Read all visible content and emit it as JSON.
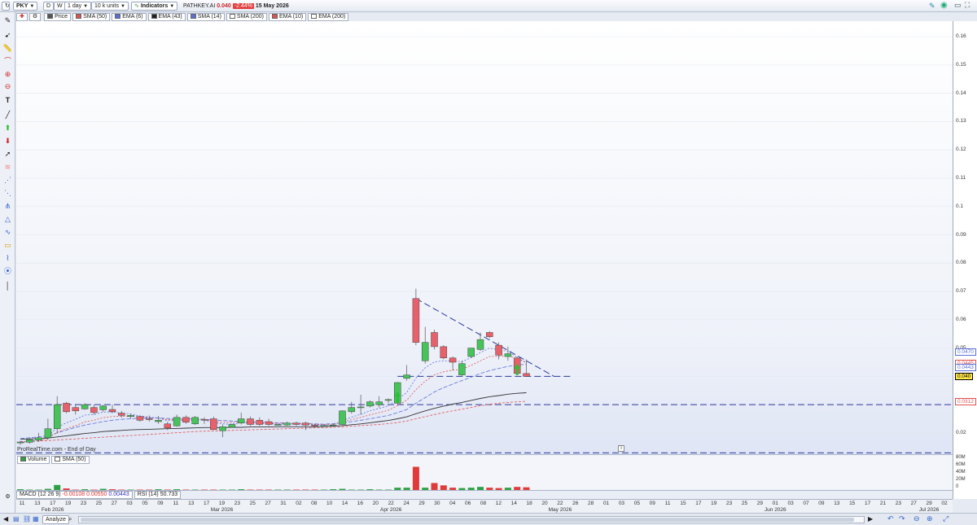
{
  "toolbar": {
    "symbol": "PKY",
    "d_label": "D",
    "w_label": "W",
    "timeframe": "1 day",
    "units": "10 k units",
    "indicators_label": "Indicators",
    "ticker": "PATHKEY.AI",
    "last_price": "0.040",
    "change": "-2.44%",
    "date": "15 May 2026"
  },
  "legend": {
    "items": [
      {
        "label": "Price",
        "color": "#555555"
      },
      {
        "label": "SMA (50)",
        "color": "#e05050"
      },
      {
        "label": "EMA (6)",
        "color": "#5a6fd6"
      },
      {
        "label": "EMA (43)",
        "color": "#222222"
      },
      {
        "label": "SMA (14)",
        "color": "#5a6fd6"
      },
      {
        "label": "SMA (200)",
        "color": "#ffffff"
      },
      {
        "label": "EMA (10)",
        "color": "#e05050"
      },
      {
        "label": "EMA (200)",
        "color": "#ffffff"
      }
    ]
  },
  "watermark": "ProRealTime.com - End of Day",
  "volume_legend": {
    "volume": "Volume",
    "sma": "SMA (50)"
  },
  "macd": {
    "label": "MACD (12 26 9)",
    "v1": "-0.00108",
    "v2": "0.00550",
    "v3": "0.00443"
  },
  "rsi": {
    "label": "RSI (14)",
    "value": "50.733"
  },
  "bottom": {
    "analyze": "Analyze"
  },
  "y_axis": {
    "ticks": [
      "0.16",
      "0.15",
      "0.14",
      "0.13",
      "0.12",
      "0.11",
      "0.1",
      "0.09",
      "0.08",
      "0.07",
      "0.06",
      "0.05",
      "0.02"
    ],
    "tags": [
      {
        "label": "0.0470",
        "color": "#5a6fd6"
      },
      {
        "label": "0.0445",
        "color": "#e05050"
      },
      {
        "label": "0.0443",
        "color": "#5a6fd6"
      },
      {
        "label": "0.040",
        "color": "#000000",
        "bg": "#ffe84a"
      },
      {
        "label": "0.0312",
        "color": "#e05050"
      }
    ]
  },
  "volume_axis": [
    "80M",
    "60M",
    "40M",
    "20M",
    "0"
  ],
  "x_axis": {
    "days": [
      "11",
      "13",
      "17",
      "19",
      "23",
      "25",
      "27",
      "03",
      "05",
      "09",
      "11",
      "13",
      "17",
      "19",
      "23",
      "25",
      "27",
      "31",
      "02",
      "08",
      "10",
      "14",
      "16",
      "20",
      "22",
      "24",
      "29",
      "30",
      "04",
      "06",
      "08",
      "12",
      "14",
      "18",
      "20",
      "22",
      "26",
      "28",
      "01",
      "03",
      "05",
      "09",
      "11",
      "15",
      "17",
      "19",
      "23",
      "25",
      "29",
      "01",
      "03",
      "07",
      "09",
      "13",
      "15",
      "17",
      "21",
      "23",
      "27",
      "29",
      "02"
    ],
    "months": [
      "Feb 2026",
      "Mar 2026",
      "Apr 2026",
      "May 2026",
      "Jun 2026",
      "Jul 2026"
    ]
  },
  "chart_data": {
    "type": "candlestick",
    "ylim": [
      0.0125,
      0.1655
    ],
    "candles": [
      {
        "o": 0.0165,
        "h": 0.0172,
        "l": 0.0158,
        "c": 0.0168
      },
      {
        "o": 0.0167,
        "h": 0.0182,
        "l": 0.0162,
        "c": 0.0176
      },
      {
        "o": 0.0175,
        "h": 0.02,
        "l": 0.0168,
        "c": 0.0183
      },
      {
        "o": 0.0183,
        "h": 0.025,
        "l": 0.0176,
        "c": 0.0215
      },
      {
        "o": 0.0215,
        "h": 0.033,
        "l": 0.02,
        "c": 0.03
      },
      {
        "o": 0.0305,
        "h": 0.031,
        "l": 0.027,
        "c": 0.0275
      },
      {
        "o": 0.029,
        "h": 0.03,
        "l": 0.0265,
        "c": 0.0278
      },
      {
        "o": 0.0285,
        "h": 0.0305,
        "l": 0.0282,
        "c": 0.03
      },
      {
        "o": 0.029,
        "h": 0.03,
        "l": 0.0265,
        "c": 0.0272
      },
      {
        "o": 0.0282,
        "h": 0.03,
        "l": 0.0275,
        "c": 0.0295
      },
      {
        "o": 0.0283,
        "h": 0.03,
        "l": 0.027,
        "c": 0.0275
      },
      {
        "o": 0.027,
        "h": 0.0278,
        "l": 0.0255,
        "c": 0.0262
      },
      {
        "o": 0.0258,
        "h": 0.0268,
        "l": 0.025,
        "c": 0.0262
      },
      {
        "o": 0.0258,
        "h": 0.0262,
        "l": 0.024,
        "c": 0.0245
      },
      {
        "o": 0.025,
        "h": 0.0262,
        "l": 0.024,
        "c": 0.0248
      },
      {
        "o": 0.024,
        "h": 0.026,
        "l": 0.0232,
        "c": 0.0245
      },
      {
        "o": 0.0232,
        "h": 0.024,
        "l": 0.021,
        "c": 0.0218
      },
      {
        "o": 0.0225,
        "h": 0.0265,
        "l": 0.0222,
        "c": 0.0255
      },
      {
        "o": 0.0255,
        "h": 0.0262,
        "l": 0.0232,
        "c": 0.0238
      },
      {
        "o": 0.0232,
        "h": 0.026,
        "l": 0.0228,
        "c": 0.0255
      },
      {
        "o": 0.0248,
        "h": 0.0255,
        "l": 0.0232,
        "c": 0.0245
      },
      {
        "o": 0.025,
        "h": 0.0258,
        "l": 0.021,
        "c": 0.0212
      },
      {
        "o": 0.0208,
        "h": 0.023,
        "l": 0.0185,
        "c": 0.0222
      },
      {
        "o": 0.022,
        "h": 0.0232,
        "l": 0.0218,
        "c": 0.023
      },
      {
        "o": 0.0235,
        "h": 0.0272,
        "l": 0.023,
        "c": 0.025
      },
      {
        "o": 0.025,
        "h": 0.0258,
        "l": 0.0225,
        "c": 0.023
      },
      {
        "o": 0.0245,
        "h": 0.0255,
        "l": 0.0225,
        "c": 0.023
      },
      {
        "o": 0.024,
        "h": 0.025,
        "l": 0.0225,
        "c": 0.023
      },
      {
        "o": 0.023,
        "h": 0.0232,
        "l": 0.0228,
        "c": 0.023
      },
      {
        "o": 0.0228,
        "h": 0.024,
        "l": 0.0225,
        "c": 0.0235
      },
      {
        "o": 0.0235,
        "h": 0.024,
        "l": 0.0225,
        "c": 0.023
      },
      {
        "o": 0.0235,
        "h": 0.024,
        "l": 0.021,
        "c": 0.0228
      },
      {
        "o": 0.0228,
        "h": 0.0232,
        "l": 0.0222,
        "c": 0.0225
      },
      {
        "o": 0.0225,
        "h": 0.023,
        "l": 0.0222,
        "c": 0.0226
      },
      {
        "o": 0.0225,
        "h": 0.0232,
        "l": 0.0222,
        "c": 0.0228
      },
      {
        "o": 0.023,
        "h": 0.028,
        "l": 0.0228,
        "c": 0.0278
      },
      {
        "o": 0.0275,
        "h": 0.031,
        "l": 0.0268,
        "c": 0.029
      },
      {
        "o": 0.029,
        "h": 0.0335,
        "l": 0.0265,
        "c": 0.0292
      },
      {
        "o": 0.0295,
        "h": 0.0315,
        "l": 0.029,
        "c": 0.031
      },
      {
        "o": 0.03,
        "h": 0.033,
        "l": 0.029,
        "c": 0.031
      },
      {
        "o": 0.0315,
        "h": 0.0322,
        "l": 0.0305,
        "c": 0.0318
      },
      {
        "o": 0.0305,
        "h": 0.038,
        "l": 0.03,
        "c": 0.0378
      },
      {
        "o": 0.0393,
        "h": 0.044,
        "l": 0.0385,
        "c": 0.0405
      },
      {
        "o": 0.0675,
        "h": 0.071,
        "l": 0.051,
        "c": 0.052
      },
      {
        "o": 0.0455,
        "h": 0.0575,
        "l": 0.0445,
        "c": 0.052
      },
      {
        "o": 0.0555,
        "h": 0.0565,
        "l": 0.0495,
        "c": 0.0505
      },
      {
        "o": 0.0505,
        "h": 0.051,
        "l": 0.046,
        "c": 0.0465
      },
      {
        "o": 0.0465,
        "h": 0.047,
        "l": 0.042,
        "c": 0.045
      },
      {
        "o": 0.0405,
        "h": 0.0455,
        "l": 0.04,
        "c": 0.0445
      },
      {
        "o": 0.047,
        "h": 0.05,
        "l": 0.0465,
        "c": 0.05
      },
      {
        "o": 0.0495,
        "h": 0.0555,
        "l": 0.049,
        "c": 0.053
      },
      {
        "o": 0.0555,
        "h": 0.056,
        "l": 0.0535,
        "c": 0.054
      },
      {
        "o": 0.051,
        "h": 0.052,
        "l": 0.046,
        "c": 0.0475
      },
      {
        "o": 0.047,
        "h": 0.0505,
        "l": 0.0455,
        "c": 0.048
      },
      {
        "o": 0.0465,
        "h": 0.047,
        "l": 0.041,
        "c": 0.041
      },
      {
        "o": 0.041,
        "h": 0.046,
        "l": 0.04,
        "c": 0.04
      }
    ],
    "volume": [
      2,
      1,
      1,
      3,
      13,
      4,
      1,
      2,
      1,
      3,
      2,
      1,
      1,
      1,
      1,
      2,
      1,
      2,
      1,
      1,
      1,
      1,
      1,
      1,
      2,
      1,
      1,
      1,
      1,
      1,
      1,
      1,
      1,
      1,
      2,
      3,
      1,
      1,
      2,
      1,
      1,
      6,
      6,
      60,
      6,
      18,
      12,
      6,
      5,
      6,
      8,
      6,
      5,
      6,
      8,
      7
    ],
    "ema6": [
      0.0167,
      0.017,
      0.0175,
      0.0188,
      0.022,
      0.0236,
      0.0248,
      0.0263,
      0.0265,
      0.0274,
      0.0274,
      0.027,
      0.0267,
      0.026,
      0.0256,
      0.0253,
      0.0243,
      0.0246,
      0.0243,
      0.0246,
      0.0246,
      0.0236,
      0.0232,
      0.0231,
      0.0236,
      0.0234,
      0.0233,
      0.0232,
      0.0231,
      0.0232,
      0.0231,
      0.023,
      0.0229,
      0.0228,
      0.0228,
      0.0243,
      0.0256,
      0.0266,
      0.0278,
      0.0287,
      0.0296,
      0.0319,
      0.0343,
      0.0394,
      0.043,
      0.0451,
      0.0455,
      0.0454,
      0.0452,
      0.0466,
      0.0484,
      0.05,
      0.0493,
      0.0489,
      0.0466,
      0.0447
    ],
    "ema10": [
      0.0167,
      0.0169,
      0.0172,
      0.018,
      0.0202,
      0.0215,
      0.0226,
      0.0239,
      0.0245,
      0.0254,
      0.0258,
      0.0259,
      0.026,
      0.0257,
      0.0255,
      0.0253,
      0.0247,
      0.0248,
      0.0246,
      0.0247,
      0.0247,
      0.0241,
      0.0238,
      0.0237,
      0.0239,
      0.0237,
      0.0236,
      0.0235,
      0.0234,
      0.0234,
      0.0233,
      0.0232,
      0.0231,
      0.023,
      0.023,
      0.0238,
      0.0247,
      0.0255,
      0.0264,
      0.0272,
      0.028,
      0.0297,
      0.0316,
      0.0353,
      0.0383,
      0.0405,
      0.0416,
      0.0422,
      0.0425,
      0.0439,
      0.0455,
      0.047,
      0.0471,
      0.0473,
      0.0462,
      0.045
    ],
    "sma14": [
      0.018,
      0.0183,
      0.0186,
      0.019,
      0.02,
      0.021,
      0.022,
      0.0228,
      0.0234,
      0.024,
      0.0245,
      0.0248,
      0.025,
      0.0252,
      0.0253,
      0.0253,
      0.0251,
      0.0251,
      0.025,
      0.025,
      0.0248,
      0.0246,
      0.0244,
      0.0242,
      0.024,
      0.0239,
      0.0238,
      0.0237,
      0.0236,
      0.0235,
      0.0234,
      0.0233,
      0.0232,
      0.0231,
      0.0233,
      0.0236,
      0.024,
      0.0245,
      0.025,
      0.0256,
      0.0262,
      0.0272,
      0.0283,
      0.0305,
      0.0325,
      0.0345,
      0.036,
      0.0373,
      0.0385,
      0.0397,
      0.041,
      0.042,
      0.0428,
      0.0435,
      0.044,
      0.0443
    ],
    "ema43": [
      0.0178,
      0.0179,
      0.018,
      0.0182,
      0.0186,
      0.019,
      0.0194,
      0.0198,
      0.0201,
      0.0205,
      0.0207,
      0.0209,
      0.0211,
      0.0212,
      0.0213,
      0.0214,
      0.0215,
      0.0216,
      0.0217,
      0.0218,
      0.0219,
      0.0219,
      0.0219,
      0.022,
      0.022,
      0.0221,
      0.0221,
      0.0221,
      0.0222,
      0.0222,
      0.0222,
      0.0222,
      0.0222,
      0.0223,
      0.0224,
      0.0226,
      0.0229,
      0.0232,
      0.0236,
      0.024,
      0.0244,
      0.025,
      0.0257,
      0.0268,
      0.0278,
      0.0287,
      0.0295,
      0.0302,
      0.0308,
      0.0315,
      0.0322,
      0.0328,
      0.0332,
      0.0337,
      0.034,
      0.0342
    ],
    "sma50": [
      0.017,
      0.0171,
      0.0172,
      0.0173,
      0.0175,
      0.0177,
      0.0179,
      0.0181,
      0.0183,
      0.0185,
      0.0187,
      0.0189,
      0.0191,
      0.0193,
      0.0195,
      0.0197,
      0.0199,
      0.0201,
      0.0203,
      0.0205,
      0.0206,
      0.0207,
      0.0208,
      0.0209,
      0.021,
      0.0211,
      0.0212,
      0.0213,
      0.0214,
      0.0215,
      0.0216,
      0.0217,
      0.0218,
      0.0219,
      0.022,
      0.0222,
      0.0224,
      0.0226,
      0.0228,
      0.023,
      0.0233,
      0.0237,
      0.0242,
      0.025,
      0.0258,
      0.0265,
      0.0272,
      0.0278,
      0.0284,
      0.029,
      0.0296,
      0.0301,
      0.0305,
      0.0308,
      0.031,
      0.0312
    ],
    "horizontal_lines": [
      0.03,
      0.04,
      0.017
    ],
    "trendline": {
      "from_index": 43,
      "from_price": 0.0675,
      "to_index": 58,
      "to_price": 0.04
    }
  }
}
